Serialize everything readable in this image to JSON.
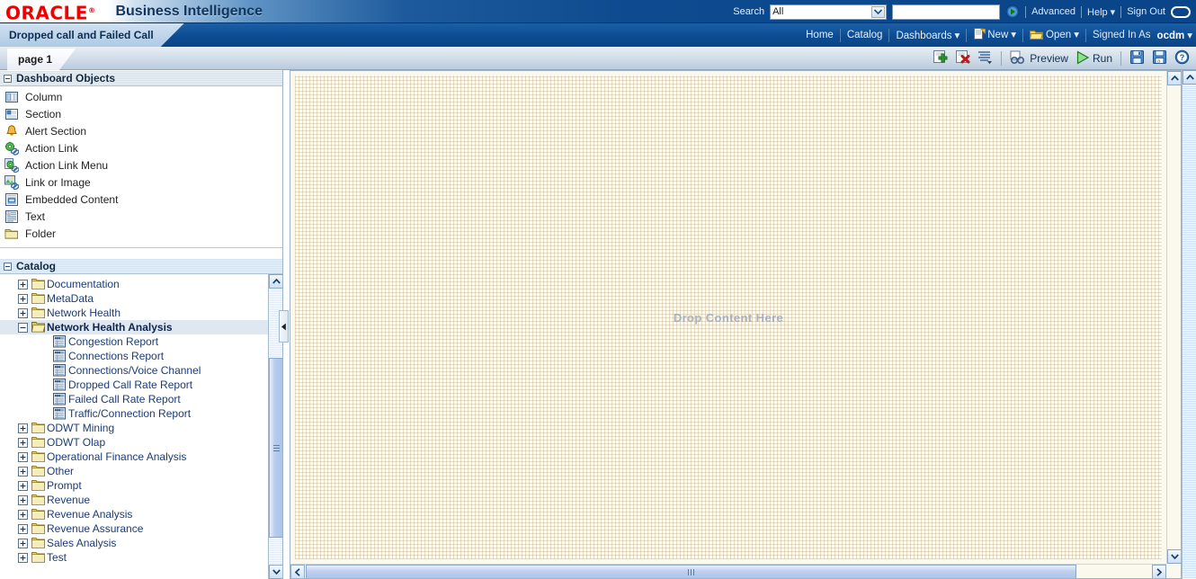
{
  "brand": {
    "logo_text": "ORACLE",
    "logo_tm": "®",
    "app_title": "Business Intelligence"
  },
  "search": {
    "label": "Search",
    "scope_value": "All",
    "scope_options": [
      "All"
    ],
    "query_value": "",
    "query_placeholder": "",
    "go_icon": "go-arrow-icon",
    "advanced_label": "Advanced",
    "help_label": "Help",
    "sign_out_label": "Sign Out",
    "user_avatar_icon": "user-oval-icon"
  },
  "dashboard_tab": {
    "title": "Dropped call and Failed Call"
  },
  "global_nav": {
    "home_label": "Home",
    "catalog_label": "Catalog",
    "dashboards_label": "Dashboards",
    "new_label": "New",
    "open_label": "Open",
    "signed_in_as_label": "Signed In As",
    "user_name": "ocdm",
    "new_icon": "new-page-icon",
    "open_icon": "open-folder-icon"
  },
  "page_tabs": {
    "tabs": [
      {
        "label": "page 1",
        "active": true
      }
    ]
  },
  "toolbar": {
    "add_page_icon": "add-page-icon",
    "delete_page_icon": "delete-page-icon",
    "page_properties_icon": "page-properties-icon",
    "preview_label": "Preview",
    "preview_icon": "preview-glasses-icon",
    "run_label": "Run",
    "run_icon": "run-play-icon",
    "save_icon": "save-icon",
    "save_as_icon": "save-as-icon",
    "help_icon": "help-question-icon"
  },
  "dashboard_objects": {
    "title": "Dashboard Objects",
    "collapsed": false,
    "items": [
      {
        "label": "Column",
        "icon": "column-icon"
      },
      {
        "label": "Section",
        "icon": "section-icon"
      },
      {
        "label": "Alert Section",
        "icon": "alert-bell-icon"
      },
      {
        "label": "Action Link",
        "icon": "action-link-icon"
      },
      {
        "label": "Action Link Menu",
        "icon": "action-link-menu-icon"
      },
      {
        "label": "Link or Image",
        "icon": "link-or-image-icon"
      },
      {
        "label": "Embedded Content",
        "icon": "embedded-content-icon"
      },
      {
        "label": "Text",
        "icon": "text-icon"
      },
      {
        "label": "Folder",
        "icon": "folder-icon"
      }
    ]
  },
  "catalog": {
    "title": "Catalog",
    "collapsed": false,
    "nodes": [
      {
        "label": "Documentation",
        "type": "folder",
        "state": "collapsed",
        "depth": 0,
        "selected": false
      },
      {
        "label": "MetaData",
        "type": "folder",
        "state": "collapsed",
        "depth": 0,
        "selected": false
      },
      {
        "label": "Network Health",
        "type": "folder",
        "state": "collapsed",
        "depth": 0,
        "selected": false
      },
      {
        "label": "Network Health Analysis",
        "type": "folder-open",
        "state": "expanded",
        "depth": 0,
        "selected": true
      },
      {
        "label": "Congestion Report",
        "type": "report",
        "state": "leaf",
        "depth": 1,
        "selected": false
      },
      {
        "label": "Connections Report",
        "type": "report",
        "state": "leaf",
        "depth": 1,
        "selected": false
      },
      {
        "label": "Connections/Voice Channel",
        "type": "report",
        "state": "leaf",
        "depth": 1,
        "selected": false
      },
      {
        "label": "Dropped Call Rate Report",
        "type": "report",
        "state": "leaf",
        "depth": 1,
        "selected": false
      },
      {
        "label": "Failed Call Rate Report",
        "type": "report",
        "state": "leaf",
        "depth": 1,
        "selected": false
      },
      {
        "label": "Traffic/Connection Report",
        "type": "report",
        "state": "leaf",
        "depth": 1,
        "selected": false
      },
      {
        "label": "ODWT Mining",
        "type": "folder",
        "state": "collapsed",
        "depth": 0,
        "selected": false
      },
      {
        "label": "ODWT Olap",
        "type": "folder",
        "state": "collapsed",
        "depth": 0,
        "selected": false
      },
      {
        "label": "Operational Finance Analysis",
        "type": "folder",
        "state": "collapsed",
        "depth": 0,
        "selected": false
      },
      {
        "label": "Other",
        "type": "folder",
        "state": "collapsed",
        "depth": 0,
        "selected": false
      },
      {
        "label": "Prompt",
        "type": "folder",
        "state": "collapsed",
        "depth": 0,
        "selected": false
      },
      {
        "label": "Revenue",
        "type": "folder",
        "state": "collapsed",
        "depth": 0,
        "selected": false
      },
      {
        "label": "Revenue Analysis",
        "type": "folder",
        "state": "collapsed",
        "depth": 0,
        "selected": false
      },
      {
        "label": "Revenue Assurance",
        "type": "folder",
        "state": "collapsed",
        "depth": 0,
        "selected": false
      },
      {
        "label": "Sales Analysis",
        "type": "folder",
        "state": "collapsed",
        "depth": 0,
        "selected": false
      },
      {
        "label": "Test",
        "type": "folder",
        "state": "collapsed",
        "depth": 0,
        "selected": false
      }
    ]
  },
  "canvas": {
    "drop_text": "Drop Content Here"
  },
  "colors": {
    "oracle_red": "#f00000",
    "header_blue": "#0a4489",
    "title_blue": "#12355e",
    "tree_link": "#1b3c73",
    "selected_bg": "#dfe7f0",
    "canvas_bg": "#fbf9ee",
    "drop_text": "#9aa8bd"
  }
}
